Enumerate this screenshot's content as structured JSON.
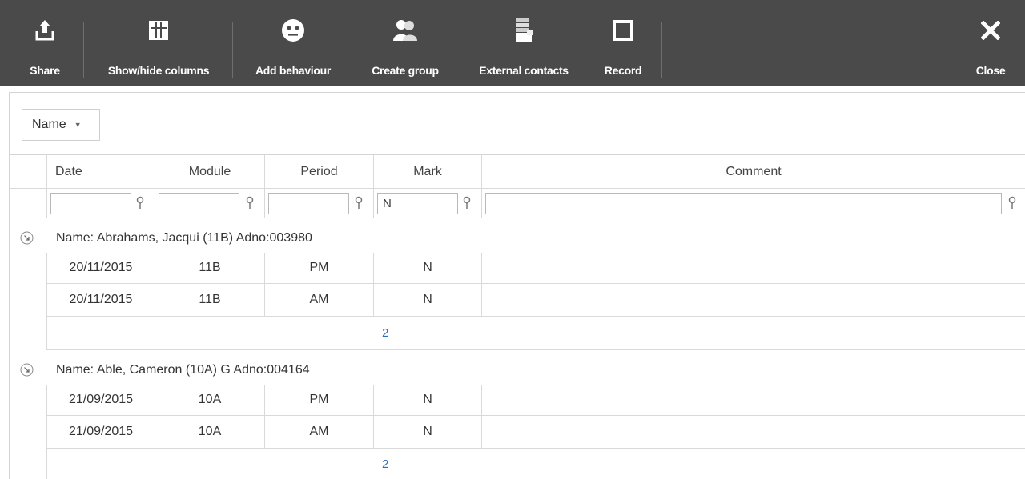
{
  "toolbar": {
    "share": {
      "label": "Share",
      "icon": "share-icon"
    },
    "show_hide_columns": {
      "label": "Show/hide columns",
      "icon": "columns-icon"
    },
    "add_behaviour": {
      "label": "Add behaviour",
      "icon": "face-icon"
    },
    "create_group": {
      "label": "Create group",
      "icon": "group-icon"
    },
    "external_contacts": {
      "label": "External contacts",
      "icon": "contacts-icon"
    },
    "record": {
      "label": "Record",
      "icon": "record-icon"
    },
    "close": {
      "label": "Close",
      "icon": "close-icon"
    }
  },
  "grouping": {
    "chip_label": "Name"
  },
  "columns": [
    "Date",
    "Module",
    "Period",
    "Mark",
    "Comment"
  ],
  "filters": {
    "date": "",
    "module": "",
    "period": "",
    "mark": "N",
    "comment": ""
  },
  "groups": [
    {
      "label": "Name: Abrahams, Jacqui (11B) Adno:003980",
      "rows": [
        {
          "date": "20/11/2015",
          "module": "11B",
          "period": "PM",
          "mark": "N",
          "comment": ""
        },
        {
          "date": "20/11/2015",
          "module": "11B",
          "period": "AM",
          "mark": "N",
          "comment": ""
        }
      ],
      "count": "2"
    },
    {
      "label": "Name: Able, Cameron (10A) G Adno:004164",
      "rows": [
        {
          "date": "21/09/2015",
          "module": "10A",
          "period": "PM",
          "mark": "N",
          "comment": ""
        },
        {
          "date": "21/09/2015",
          "module": "10A",
          "period": "AM",
          "mark": "N",
          "comment": ""
        }
      ],
      "count": "2"
    }
  ],
  "colors": {
    "toolbar_bg": "#4a4a4a",
    "count_text": "#2a6ebb",
    "grid_line": "#d9d9d9"
  }
}
